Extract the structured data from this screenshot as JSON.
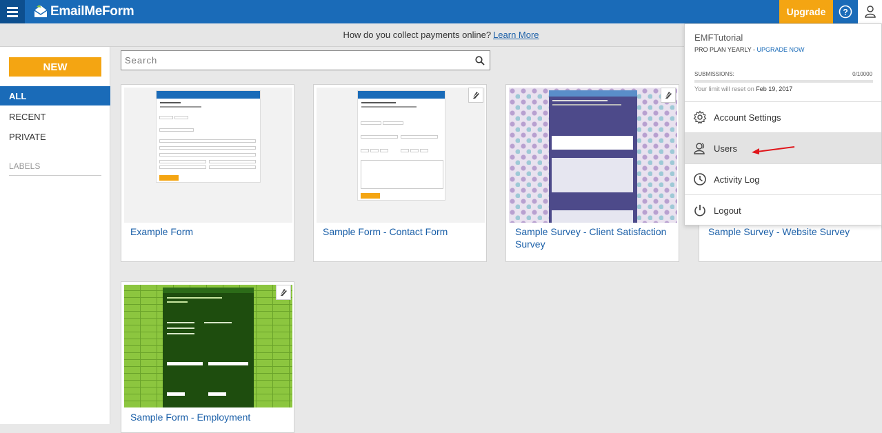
{
  "header": {
    "logo_text": "EmailMeForm",
    "upgrade_label": "Upgrade",
    "colors": {
      "bar": "#1a6bb8",
      "menu": "#0d4f8f",
      "accent": "#f4a512"
    }
  },
  "notice": {
    "text": "How do you collect payments online?",
    "link": "Learn More"
  },
  "sidebar": {
    "new_label": "NEW",
    "items": [
      {
        "label": "ALL"
      },
      {
        "label": "RECENT"
      },
      {
        "label": "PRIVATE"
      }
    ],
    "labels_heading": "LABELS"
  },
  "search": {
    "placeholder": "Search"
  },
  "forms": [
    {
      "title": "Example Form"
    },
    {
      "title": "Sample Form - Contact Form"
    },
    {
      "title": "Sample Survey - Client Satisfaction Survey"
    },
    {
      "title": "Sample Survey - Website Survey"
    },
    {
      "title": "Sample Form - Employment"
    }
  ],
  "account_menu": {
    "username": "EMFTutorial",
    "plan": "PRO PLAN YEARLY - ",
    "upgrade_link": "UPGRADE NOW",
    "submissions_label": "SUBMISSIONS:",
    "submissions_value": "0/10000",
    "submissions_fraction": 0,
    "reset_text": "Your limit will reset on ",
    "reset_date": "Feb 19, 2017",
    "items": [
      {
        "label": "Account Settings",
        "icon": "gear-icon"
      },
      {
        "label": "Users",
        "icon": "users-icon"
      },
      {
        "label": "Activity Log",
        "icon": "clock-icon"
      },
      {
        "label": "Logout",
        "icon": "power-icon"
      }
    ]
  }
}
